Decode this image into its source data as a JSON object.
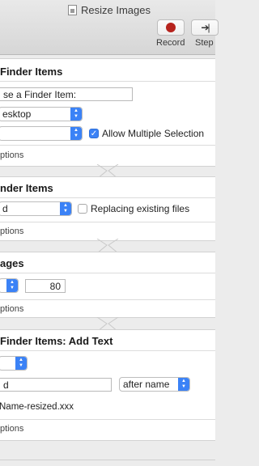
{
  "window": {
    "title": "Resize Images"
  },
  "toolbar": {
    "record_label": "Record",
    "step_label": "Step"
  },
  "actions": [
    {
      "title": "Finder Items",
      "prompt_field": "se a Finder Item:",
      "location_popup": "esktop",
      "allow_multiple_label": "Allow Multiple Selection",
      "allow_multiple_checked": true,
      "options_label": "ptions"
    },
    {
      "title": "nder Items",
      "copy_popup": "d",
      "replacing_label": "Replacing existing files",
      "replacing_checked": false,
      "options_label": "ptions"
    },
    {
      "title": "ages",
      "size_value": "80",
      "options_label": "ptions"
    },
    {
      "title": " Finder Items: Add Text",
      "text_field": "d",
      "position_popup": "after name",
      "example_text": "Name-resized.xxx",
      "options_label": "ptions"
    }
  ],
  "icons": {
    "document": "document-icon",
    "record": "record-dot-icon",
    "step": "step-icon",
    "popup_arrows": "popup-arrows-icon",
    "options_disclosure": "disclosure-triangle-icon",
    "checkmark": "checkmark-icon"
  }
}
